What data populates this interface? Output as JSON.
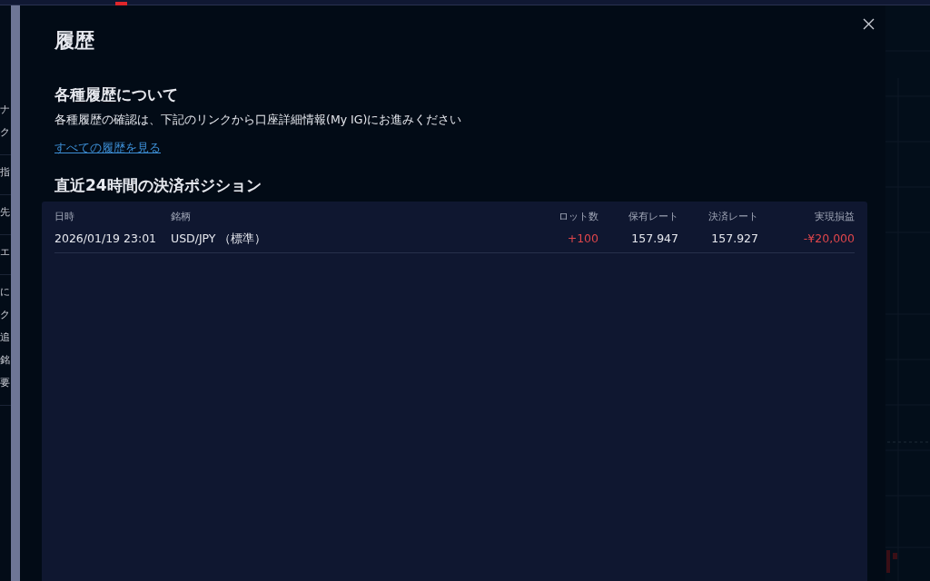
{
  "background_sidebar": {
    "groups": [
      [
        "ナ",
        "ク"
      ],
      [
        "指"
      ],
      [
        "先"
      ],
      [
        "エ"
      ],
      [
        "に",
        "ク",
        "追",
        "銘",
        "要"
      ]
    ]
  },
  "dialog": {
    "title": "履歴",
    "about": {
      "heading": "各種履歴について",
      "text": "各種履歴の確認は、下記のリンクから口座詳細情報(My IG)にお進みください",
      "link": "すべての履歴を見る"
    },
    "closed_positions": {
      "heading": "直近24時間の決済ポジション",
      "table": {
        "columns": [
          "日時",
          "銘柄",
          "ロット数",
          "保有レート",
          "決済レート",
          "実現損益"
        ],
        "rows": [
          [
            {
              "text": "2026/01/19 23:01"
            },
            {
              "text": "USD/JPY （標準）"
            },
            {
              "text": "+100",
              "color": "#e0464b"
            },
            {
              "text": "157.947"
            },
            {
              "text": "157.927"
            },
            {
              "text": "-¥20,000",
              "color": "#e0464b"
            }
          ]
        ]
      }
    }
  }
}
